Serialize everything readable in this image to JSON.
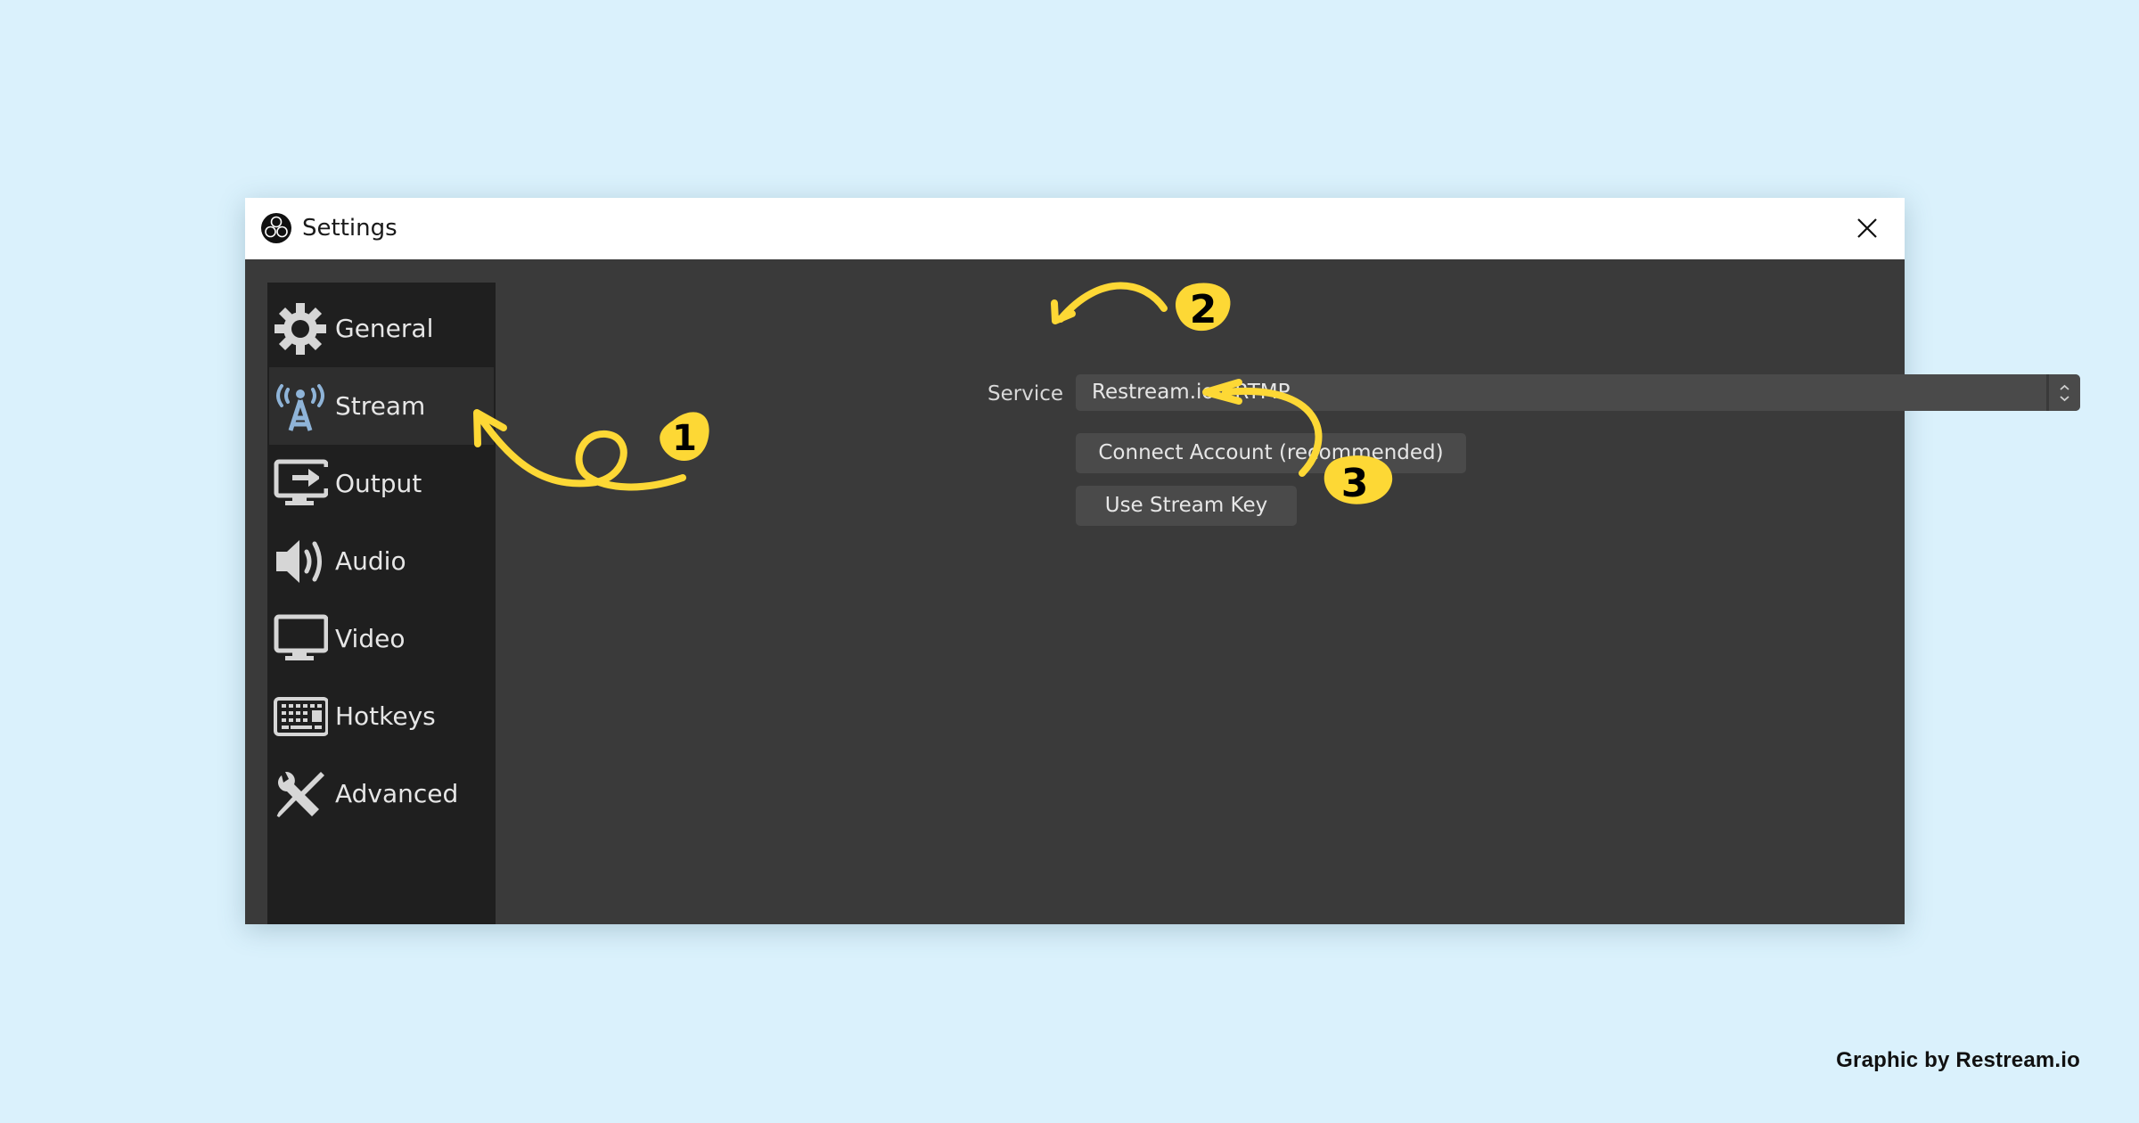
{
  "window": {
    "title": "Settings",
    "logo_icon": "obs-logo-icon",
    "close_icon": "close-icon"
  },
  "sidebar": {
    "selected": "Stream",
    "items": [
      {
        "label": "General",
        "icon": "gear-icon"
      },
      {
        "label": "Stream",
        "icon": "antenna-icon"
      },
      {
        "label": "Output",
        "icon": "monitor-output-icon"
      },
      {
        "label": "Audio",
        "icon": "speaker-icon"
      },
      {
        "label": "Video",
        "icon": "monitor-icon"
      },
      {
        "label": "Hotkeys",
        "icon": "keyboard-icon"
      },
      {
        "label": "Advanced",
        "icon": "tools-icon"
      }
    ]
  },
  "stream": {
    "service_label": "Service",
    "service_value": "Restream.io - RTMP",
    "connect_button": "Connect Account (recommended)",
    "stream_key_button": "Use Stream Key"
  },
  "annotations": {
    "color": "#fdd835",
    "steps": [
      "1",
      "2",
      "3"
    ]
  },
  "credit": "Graphic by Restream.io"
}
